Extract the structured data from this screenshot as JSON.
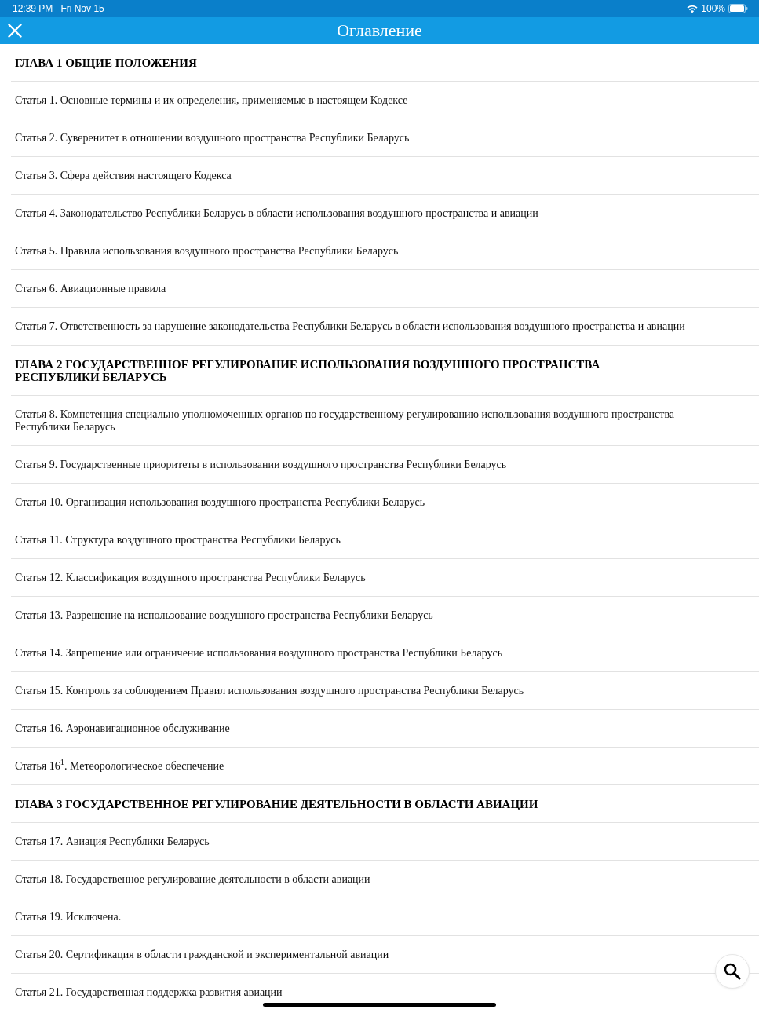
{
  "status_bar": {
    "time": "12:39 PM",
    "date": "Fri Nov 15",
    "battery": "100%"
  },
  "header": {
    "title": "Оглавление"
  },
  "toc": [
    {
      "kind": "chapter",
      "text": "ГЛАВА 1 ОБЩИЕ ПОЛОЖЕНИЯ"
    },
    {
      "kind": "article",
      "text": "Статья 1. Основные термины и их определения, применяемые в настоящем Кодексе"
    },
    {
      "kind": "article",
      "text": "Статья 2. Суверенитет в отношении воздушного пространства Республики Беларусь"
    },
    {
      "kind": "article",
      "text": "Статья 3. Сфера действия настоящего Кодекса"
    },
    {
      "kind": "article",
      "text": "Статья 4. Законодательство Республики Беларусь в области использования воздушного пространства и авиации"
    },
    {
      "kind": "article",
      "text": "Статья 5. Правила использования воздушного пространства Республики Беларусь"
    },
    {
      "kind": "article",
      "text": "Статья 6. Авиационные правила"
    },
    {
      "kind": "article",
      "text": "Статья 7. Ответственность за нарушение законодательства Республики Беларусь в области использования воздушного пространства и авиации"
    },
    {
      "kind": "chapter",
      "text": "ГЛАВА 2 ГОСУДАРСТВЕННОЕ РЕГУЛИРОВАНИЕ ИСПОЛЬЗОВАНИЯ ВОЗДУШНОГО ПРОСТРАНСТВА РЕСПУБЛИКИ БЕЛАРУСЬ"
    },
    {
      "kind": "article",
      "text": "Статья 8. Компетенция специально уполномоченных органов по государственному регулированию использования воздушного пространства Республики Беларусь"
    },
    {
      "kind": "article",
      "text": "Статья 9. Государственные приоритеты в использовании воздушного пространства Республики Беларусь"
    },
    {
      "kind": "article",
      "text": "Статья 10. Организация использования воздушного пространства Республики Беларусь"
    },
    {
      "kind": "article",
      "text": "Статья 11. Структура воздушного пространства Республики Беларусь"
    },
    {
      "kind": "article",
      "text": "Статья 12. Классификация воздушного пространства Республики Беларусь"
    },
    {
      "kind": "article",
      "text": "Статья 13. Разрешение на использование воздушного пространства Республики Беларусь"
    },
    {
      "kind": "article",
      "text": "Статья 14. Запрещение или ограничение использования воздушного пространства Республики Беларусь"
    },
    {
      "kind": "article",
      "text": "Статья 15. Контроль за соблюдением Правил использования воздушного пространства Республики Беларусь"
    },
    {
      "kind": "article",
      "text": "Статья 16. Аэронавигационное обслуживание"
    },
    {
      "kind": "article",
      "text": "Статья 16$^{1}$. Метеорологическое обеспечение"
    },
    {
      "kind": "chapter",
      "text": "ГЛАВА 3 ГОСУДАРСТВЕННОЕ РЕГУЛИРОВАНИЕ ДЕЯТЕЛЬНОСТИ В ОБЛАСТИ АВИАЦИИ"
    },
    {
      "kind": "article",
      "text": "Статья 17. Авиация Республики Беларусь"
    },
    {
      "kind": "article",
      "text": "Статья 18. Государственное регулирование деятельности в области авиации"
    },
    {
      "kind": "article",
      "text": "Статья 19. Исключена."
    },
    {
      "kind": "article",
      "text": "Статья 20. Сертификация в области гражданской и экспериментальной авиации"
    },
    {
      "kind": "article",
      "text": "Статья 21. Государственная поддержка развития авиации"
    }
  ]
}
